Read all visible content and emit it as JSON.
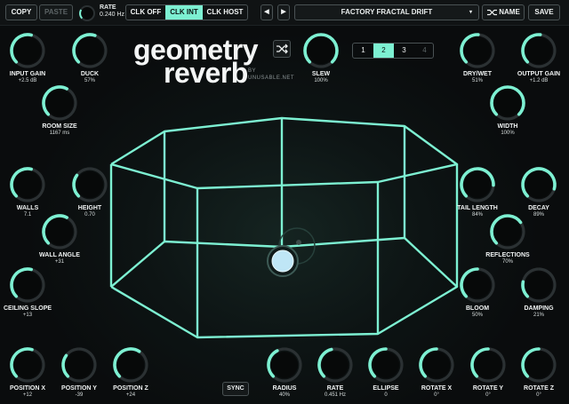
{
  "colors": {
    "accent": "#7df0d2",
    "track": "#2b3133",
    "panel": "#0b0e0f"
  },
  "topbar": {
    "copy_label": "COPY",
    "paste_label": "PASTE",
    "rate_label": "RATE",
    "rate_value": "0.240 Hz",
    "clock_modes": [
      "CLK OFF",
      "CLK INT",
      "CLK HOST"
    ],
    "clock_active": 1,
    "prev_label": "◀",
    "next_label": "▶",
    "preset_name": "FACTORY FRACTAL DRIFT",
    "preset_caret": "▾",
    "name_label": "NAME",
    "save_label": "SAVE"
  },
  "logo": {
    "line1": "geometry",
    "line2": "reverb",
    "by": "BY",
    "maker": "UNUSABLE.NET"
  },
  "tabs": {
    "labels": [
      "1",
      "2",
      "3",
      "4"
    ],
    "active": 1
  },
  "knobs": [
    {
      "id": "input-gain",
      "label": "INPUT GAIN",
      "value": "+2.5 dB",
      "level": 0.55
    },
    {
      "id": "duck",
      "label": "DUCK",
      "value": "57%",
      "level": 0.57
    },
    {
      "id": "room-size",
      "label": "ROOM SIZE",
      "value": "1167 ms",
      "level": 0.6
    },
    {
      "id": "slew",
      "label": "SLEW",
      "value": "100%",
      "level": 1.0
    },
    {
      "id": "dry-wet",
      "label": "DRY/WET",
      "value": "51%",
      "level": 0.51
    },
    {
      "id": "output-gain",
      "label": "OUTPUT GAIN",
      "value": "+1.2 dB",
      "level": 0.52
    },
    {
      "id": "width",
      "label": "WIDTH",
      "value": "100%",
      "level": 1.0
    },
    {
      "id": "walls",
      "label": "WALLS",
      "value": "7.1",
      "level": 0.55
    },
    {
      "id": "height",
      "label": "HEIGHT",
      "value": "0.70",
      "level": 0.3
    },
    {
      "id": "wall-angle",
      "label": "WALL ANGLE",
      "value": "+31",
      "level": 0.6
    },
    {
      "id": "ceiling-slope",
      "label": "CEILING SLOPE",
      "value": "+13",
      "level": 0.55
    },
    {
      "id": "tail-length",
      "label": "TAIL LENGTH",
      "value": "84%",
      "level": 0.84
    },
    {
      "id": "decay",
      "label": "DECAY",
      "value": "89%",
      "level": 0.89
    },
    {
      "id": "reflections",
      "label": "REFLECTIONS",
      "value": "70%",
      "level": 0.7
    },
    {
      "id": "bloom",
      "label": "BLOOM",
      "value": "50%",
      "level": 0.5
    },
    {
      "id": "damping",
      "label": "DAMPING",
      "value": "21%",
      "level": 0.21
    },
    {
      "id": "position-x",
      "label": "POSITION X",
      "value": "+12",
      "level": 0.56
    },
    {
      "id": "position-y",
      "label": "POSITION Y",
      "value": "-39",
      "level": 0.3
    },
    {
      "id": "position-z",
      "label": "POSITION Z",
      "value": "+24",
      "level": 0.62
    },
    {
      "id": "radius",
      "label": "RADIUS",
      "value": "40%",
      "level": 0.4
    },
    {
      "id": "rate",
      "label": "RATE",
      "value": "0.451 Hz",
      "level": 0.45
    },
    {
      "id": "ellipse",
      "label": "ELLIPSE",
      "value": "0",
      "level": 0.5
    },
    {
      "id": "rotate-x",
      "label": "ROTATE X",
      "value": "0°",
      "level": 0.5
    },
    {
      "id": "rotate-y",
      "label": "ROTATE Y",
      "value": "0°",
      "level": 0.5
    },
    {
      "id": "rotate-z",
      "label": "ROTATE Z",
      "value": "0°",
      "level": 0.5
    }
  ],
  "sync_label": "SYNC",
  "icons": {
    "shuffle": "shuffle-icon",
    "dice": "random-icon",
    "prev": "triangle-left-icon",
    "next": "triangle-right-icon"
  }
}
